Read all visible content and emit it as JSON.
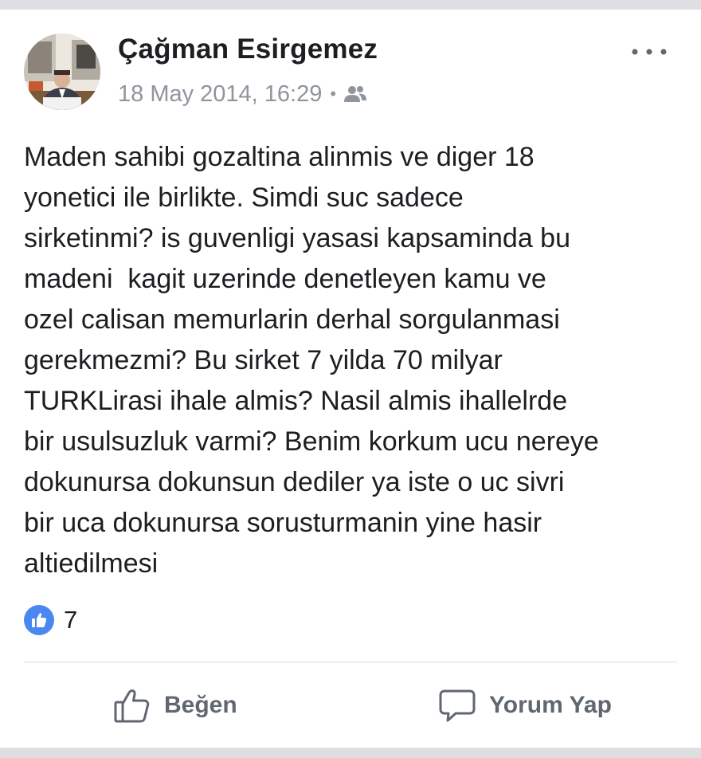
{
  "post": {
    "author": "Çağman Esirgemez",
    "timestamp": "18 May 2014, 16:29",
    "separator": "•",
    "audience_icon": "friends-icon",
    "more_icon": "more-options-icon",
    "text": "Maden sahibi gozaltina alinmis ve diger 18\nyonetici ile birlikte. Simdi suc sadece\nsirketinmi? is guvenligi yasasi kapsaminda bu\nmadeni  kagit uzerinde denetleyen kamu ve\nozel calisan memurlarin derhal sorgulanmasi\ngerekmezmi? Bu sirket 7 yilda 70 milyar\nTURKLirasi ihale almis? Nasil almis ihallelrde\nbir usulsuzluk varmi? Benim korkum ucu nereye\ndokunursa dokunsun dediler ya iste o uc sivri\nbir uca dokunursa sorusturmanin yine hasir\naltiedilmesi"
  },
  "reactions": {
    "icon": "like-reaction-icon",
    "count": "7"
  },
  "actions": {
    "like_label": "Beğen",
    "comment_label": "Yorum Yap"
  },
  "colors": {
    "like_blue": "#4a88f0",
    "muted_text": "#90949c",
    "action_text": "#606770"
  }
}
